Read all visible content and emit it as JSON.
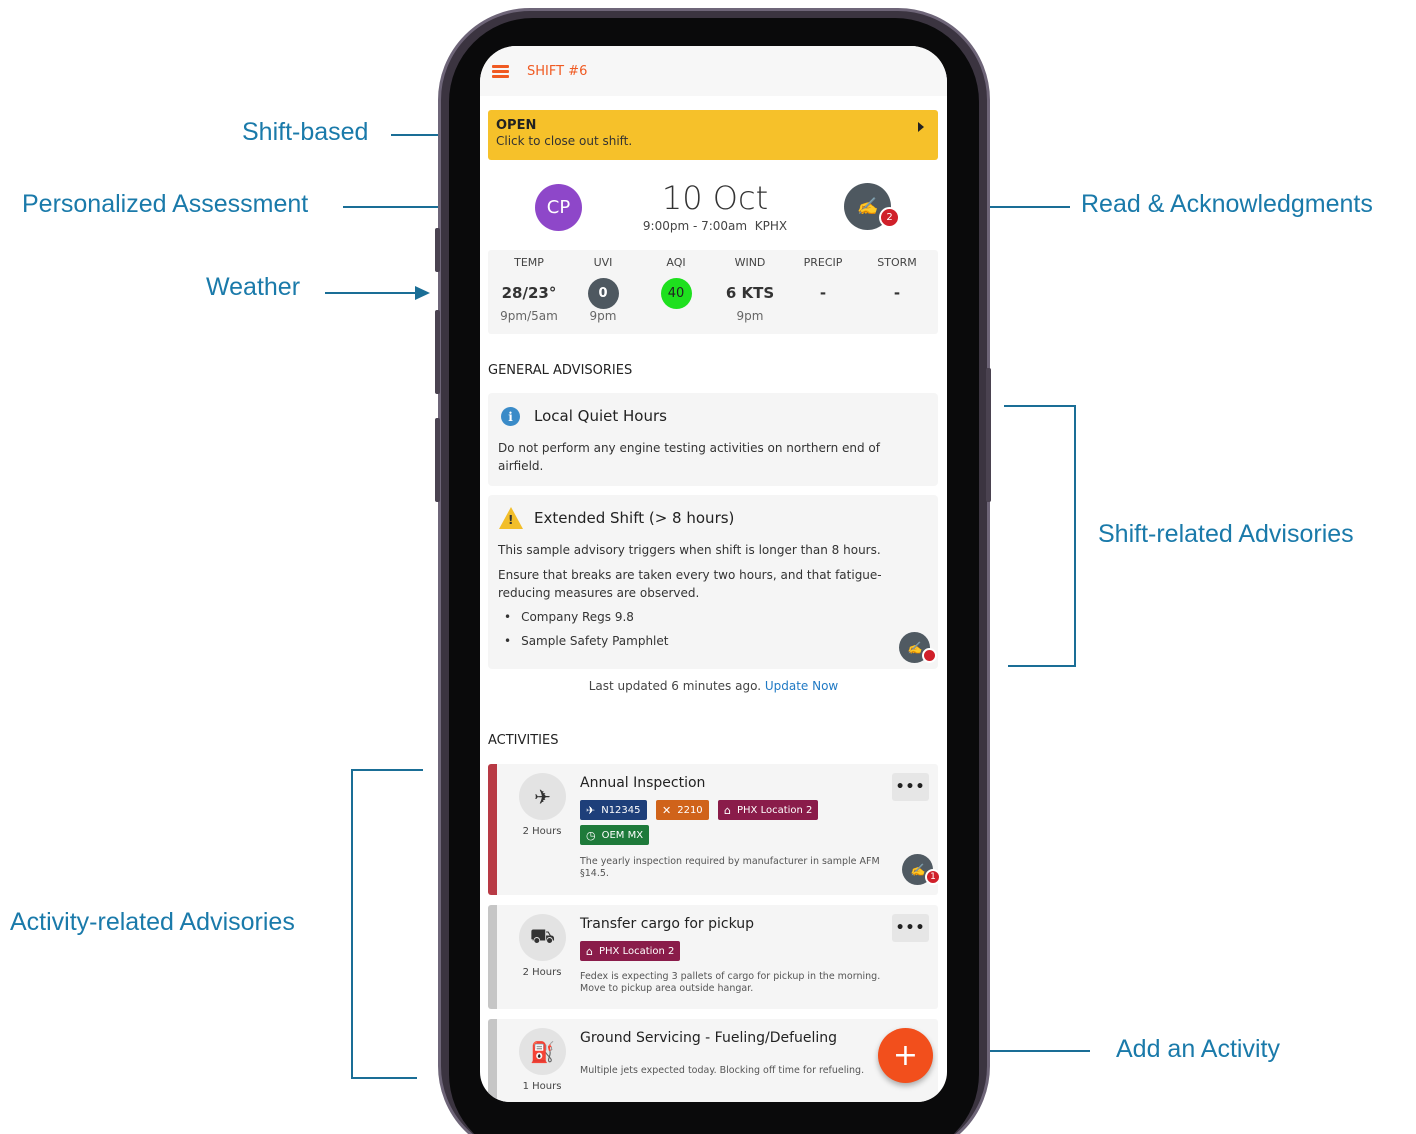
{
  "annotations": {
    "shift_based": "Shift-based",
    "personalized": "Personalized Assessment",
    "weather": "Weather",
    "read_ack": "Read & Acknowledgments",
    "shift_related": "Shift-related Advisories",
    "activity_related": "Activity-related Advisories",
    "add_activity": "Add an Activity"
  },
  "header": {
    "title": "SHIFT #6"
  },
  "status_bar": {
    "state": "OPEN",
    "hint": "Click to close out shift."
  },
  "user": {
    "initials": "CP",
    "avatar_color": "#8e47c9"
  },
  "shift": {
    "date": "10 Oct",
    "time_range": "9:00pm - 7:00am",
    "airport": "KPHX",
    "ack_count": "2"
  },
  "weather": {
    "temp": {
      "label": "TEMP",
      "value": "28/23°",
      "sub": "9pm/5am"
    },
    "uvi": {
      "label": "UVI",
      "value": "0",
      "sub": "9pm",
      "color": "#4e5860"
    },
    "aqi": {
      "label": "AQI",
      "value": "40",
      "sub": "",
      "color": "#1ee01e"
    },
    "wind": {
      "label": "WIND",
      "value": "6 KTS",
      "sub": "9pm"
    },
    "precip": {
      "label": "PRECIP",
      "value": "-",
      "sub": ""
    },
    "storm": {
      "label": "STORM",
      "value": "-",
      "sub": ""
    }
  },
  "general_advisories": {
    "title": "GENERAL ADVISORIES",
    "items": [
      {
        "icon": "info-icon",
        "title": "Local Quiet Hours",
        "body": "Do not perform any engine testing activities on northern end of airfield."
      },
      {
        "icon": "warning-icon",
        "title": "Extended Shift (> 8 hours)",
        "body1": "This sample advisory triggers when shift is longer than 8 hours.",
        "body2": "Ensure that breaks are taken every two hours, and that fatigue-reducing measures are observed.",
        "refs": [
          "Company Regs 9.8",
          "Sample Safety Pamphlet"
        ]
      }
    ],
    "updated_text": "Last updated 6 minutes ago.",
    "update_link": "Update Now"
  },
  "activities": {
    "title": "ACTIVITIES",
    "items": [
      {
        "icon": "airplane-icon",
        "title": "Annual Inspection",
        "duration": "2 Hours",
        "tags": [
          "N12345",
          "2210",
          "PHX Location 2",
          "OEM MX"
        ],
        "desc": "The yearly inspection required by manufacturer in sample AFM §14.5.",
        "ack_count": "1"
      },
      {
        "icon": "hand-truck-icon",
        "title": "Transfer cargo for pickup",
        "duration": "2 Hours",
        "tags": [
          "PHX Location 2"
        ],
        "desc": "Fedex is expecting 3 pallets of cargo for pickup in the morning. Move to pickup area outside hangar."
      },
      {
        "icon": "fuel-pump-icon",
        "title": "Ground Servicing - Fueling/Defueling",
        "duration": "1 Hours",
        "desc": "Multiple jets expected today. Blocking off time for refueling."
      }
    ]
  },
  "colors": {
    "accent": "#f05a22",
    "annotation": "#1a7aaa",
    "open_bar": "#f6c12a",
    "tag_aircraft": "#1e3f7a",
    "tag_task": "#d0631a",
    "tag_location": "#8a1c4a",
    "tag_oem": "#1e7a3a"
  }
}
